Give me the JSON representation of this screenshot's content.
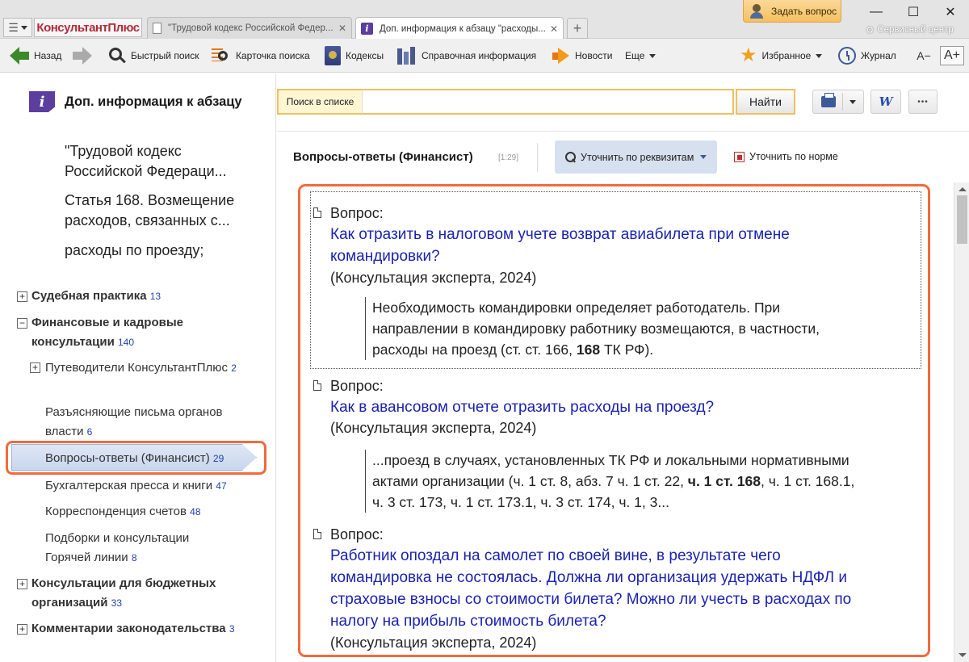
{
  "titlebar": {
    "logo": "КонсультантПлюс",
    "tabs": [
      {
        "label": "\"Трудовой кодекс Российской Федер...",
        "close": "✕"
      },
      {
        "label": "Доп. информация к абзацу \"расходы...",
        "close": "✕"
      }
    ],
    "new_tab": "+",
    "ask_question": "Задать вопрос",
    "service_center": "Сервисный центр",
    "win_min": "—",
    "win_max": "☐",
    "win_close": "✕"
  },
  "toolbar": {
    "back": "Назад",
    "quick_search": "Быстрый поиск",
    "search_card": "Карточка поиска",
    "codexes": "Кодексы",
    "reference": "Справочная информация",
    "news": "Новости",
    "more": "Еще",
    "favorites": "Избранное",
    "journal": "Журнал",
    "font_minus": "A−",
    "font_plus": "A+"
  },
  "left": {
    "title": "Доп. информация к абзацу",
    "lines": [
      "\"Трудовой кодекс Российской Федераци...",
      "Статья 168. Возмещение расходов, связанных с...",
      "расходы по проезду;"
    ],
    "tree": [
      {
        "label": "Судебная практика",
        "count": "13"
      },
      {
        "label": "Финансовые и кадровые консультации",
        "count": "140"
      },
      {
        "label": "Путеводители КонсультантПлюс",
        "count": "2"
      },
      {
        "label": "Разъясняющие письма органов власти",
        "count": "6"
      },
      {
        "label": "Вопросы-ответы (Финансист)",
        "count": "29"
      },
      {
        "label": "Бухгалтерская пресса и книги",
        "count": "47"
      },
      {
        "label": "Корреспонденция счетов",
        "count": "48"
      },
      {
        "label": "Подборки и консультации Горячей линии",
        "count": "8"
      },
      {
        "label": "Консультации для бюджетных организаций",
        "count": "33"
      },
      {
        "label": "Комментарии законодательства",
        "count": "3"
      }
    ]
  },
  "search": {
    "label": "Поиск в списке",
    "value": "",
    "button": "Найти"
  },
  "actions": {
    "word": "W",
    "more": "•••"
  },
  "content": {
    "title": "Вопросы-ответы (Финансист)",
    "range": "[1:29]",
    "refine_button": "Уточнить по реквизитам",
    "norm_link": "Уточнить по норме"
  },
  "results": [
    {
      "label": "Вопрос:",
      "link": "Как отразить в налоговом учете возврат авиабилета при отмене командировки?",
      "source": "(Консультация эксперта, 2024)",
      "quote_html": "Необходимость командировки определяет работодатель. При направлении в командировку работнику возмещаются, в частности, расходы на проезд (ст. ст. 166, <b>168</b> ТК РФ)."
    },
    {
      "label": "Вопрос:",
      "link": "Как в авансовом отчете отразить расходы на проезд?",
      "source": "(Консультация эксперта, 2024)",
      "quote_html": "...проезд в случаях, установленных ТК РФ и локальными нормативными актами организации (ч. 1 ст. 8, абз. 7 ч. 1 ст. 22, <b>ч. 1 ст. 168</b>, ч. 1 ст. 168.1, ч. 3 ст. 173, ч. 1 ст. 173.1, ч. 3 ст. 174, ч. 1, 3..."
    },
    {
      "label": "Вопрос:",
      "link": "Работник опоздал на самолет по своей вине, в результате чего командировка не состоялась. Должна ли организация удержать НДФЛ и страховые взносы со стоимости билета? Можно ли учесть в расходах по налогу на прибыль стоимость билета?",
      "source": "(Консультация эксперта, 2024)"
    }
  ],
  "colors": {
    "accent_orange": "#f26a3c",
    "link_blue": "#1a23b0",
    "brand_red": "#b22b3b",
    "info_purple": "#5b3e9e"
  }
}
